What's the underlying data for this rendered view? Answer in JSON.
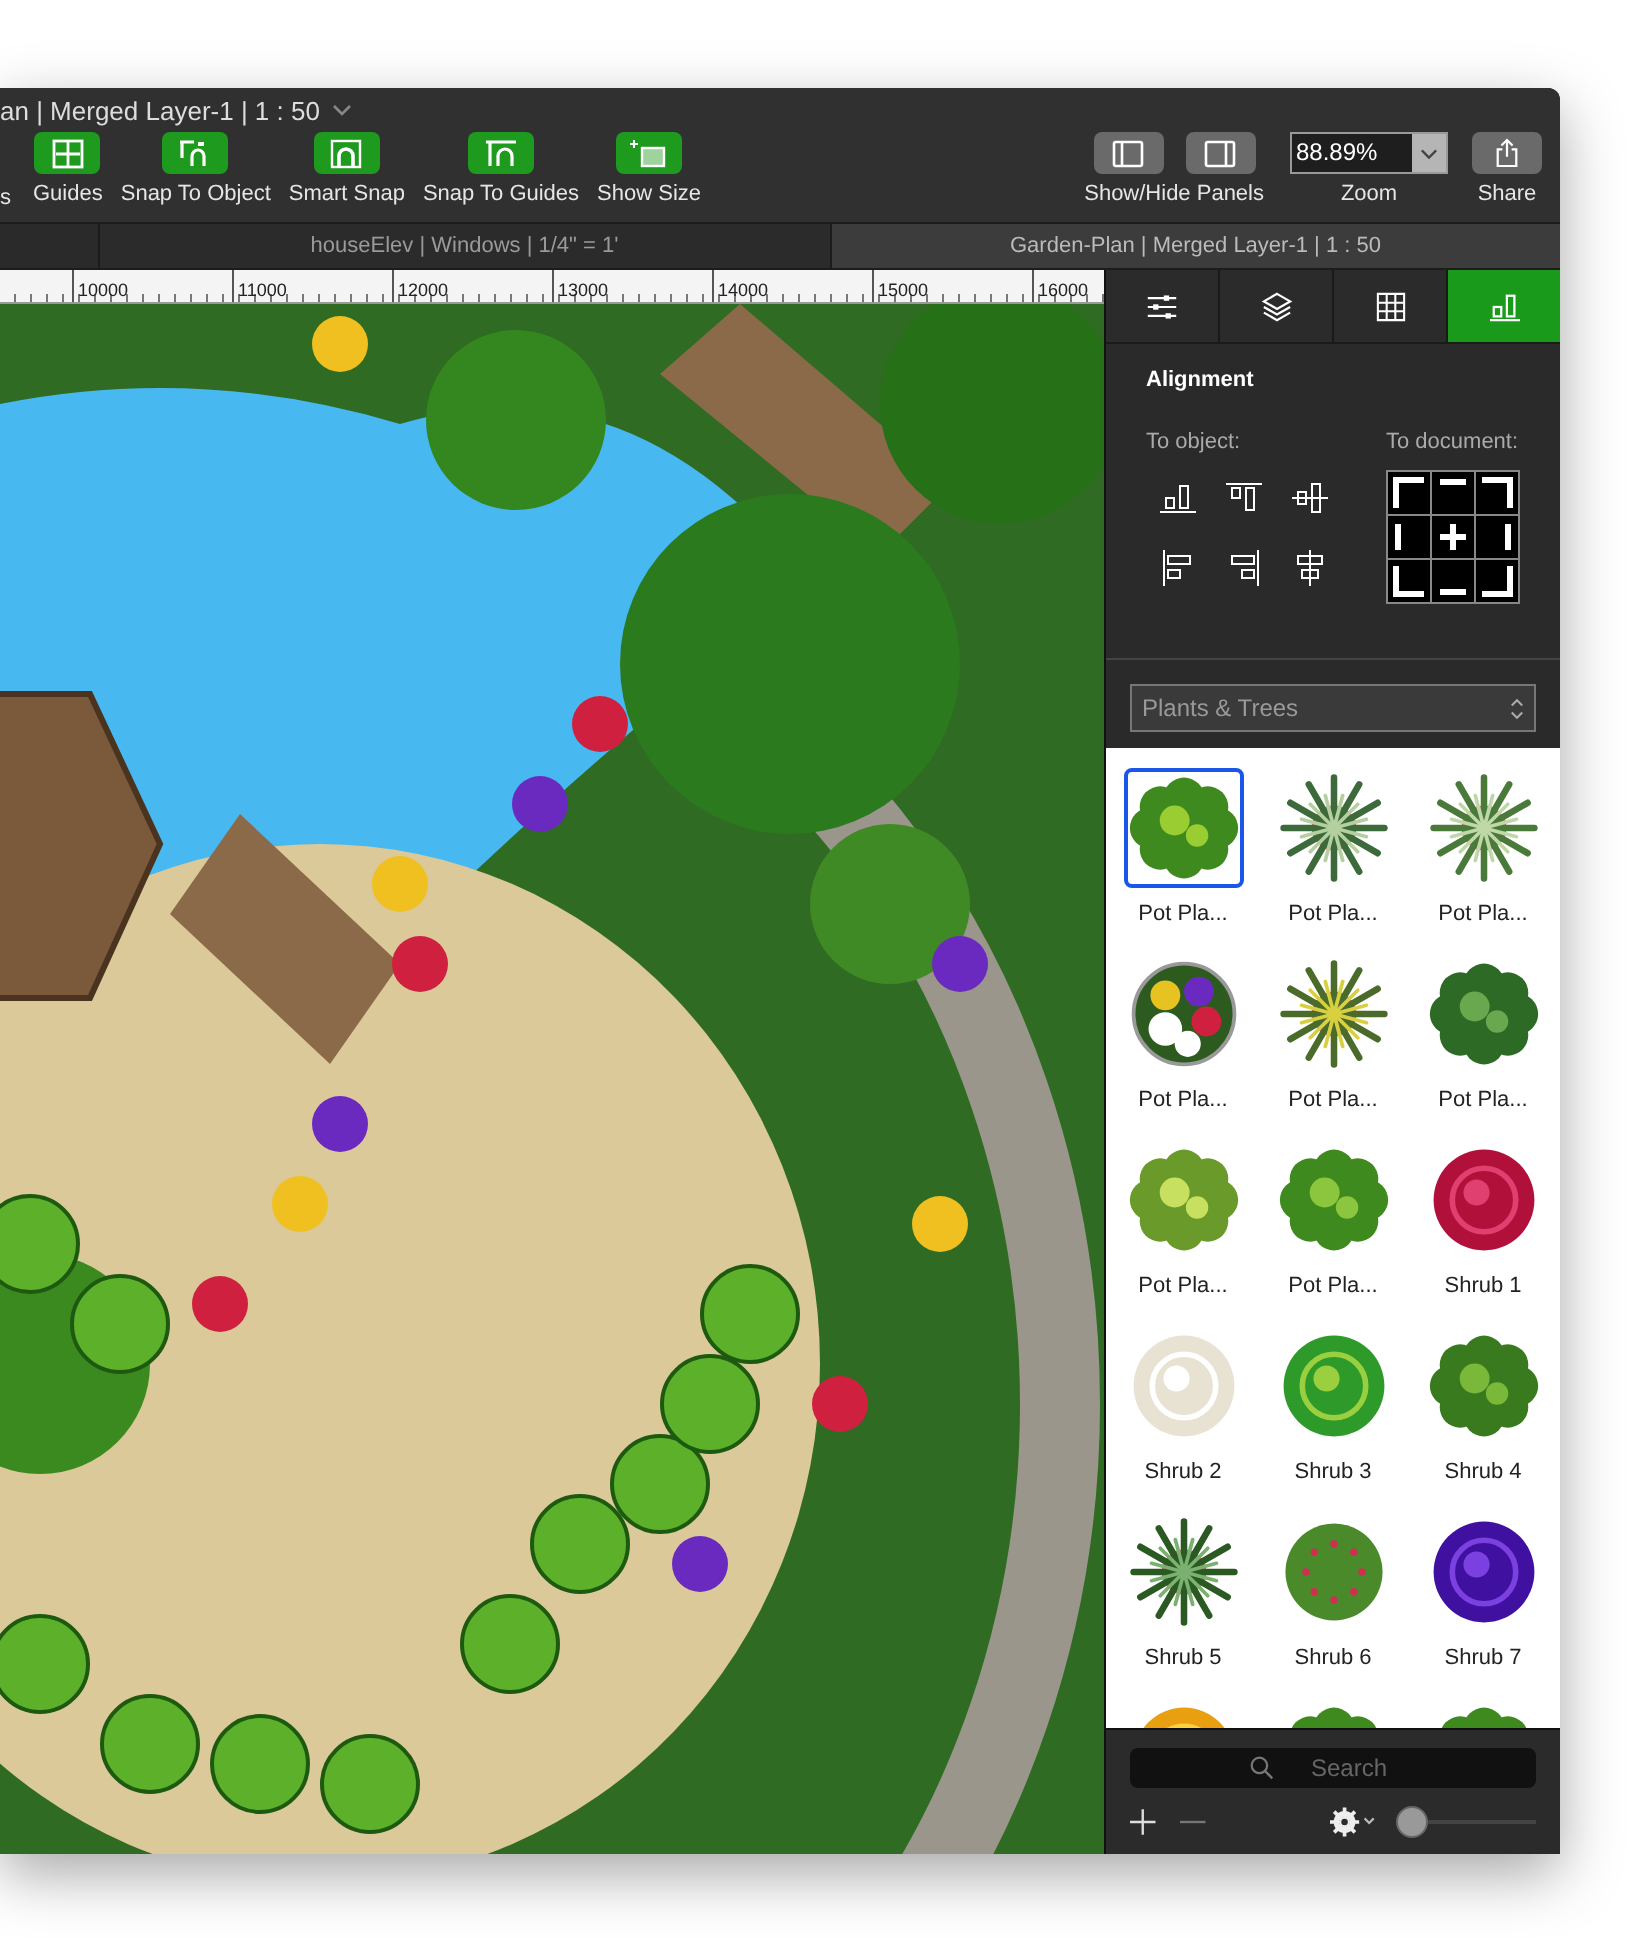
{
  "window": {
    "title": "an | Merged Layer-1 | 1 : 50"
  },
  "toolbar": {
    "cut_label": "s",
    "buttons": [
      {
        "label": "Guides",
        "on": true
      },
      {
        "label": "Snap To Object",
        "on": true
      },
      {
        "label": "Smart Snap",
        "on": true
      },
      {
        "label": "Snap To Guides",
        "on": true
      },
      {
        "label": "Show Size",
        "on": true
      }
    ],
    "panels_label": "Show/Hide Panels",
    "zoom": {
      "value": "88.89%",
      "label": "Zoom"
    },
    "share_label": "Share"
  },
  "document_tabs": [
    {
      "label": "houseElev | Windows | 1/4\" = 1'",
      "selected": false
    },
    {
      "label": "Garden-Plan | Merged Layer-1 | 1 : 50",
      "selected": true
    }
  ],
  "ruler": [
    "10000",
    "11000",
    "12000",
    "13000",
    "14000",
    "15000",
    "16000"
  ],
  "inspector": {
    "tabs": [
      {
        "selected": false
      },
      {
        "selected": false
      },
      {
        "selected": false
      },
      {
        "selected": true
      }
    ],
    "section_title": "Alignment",
    "to_object_label": "To object:",
    "to_document_label": "To document:",
    "library": "Plants & Trees",
    "items": [
      {
        "label": "Pot Pla...",
        "selected": true
      },
      {
        "label": "Pot Pla...",
        "selected": false
      },
      {
        "label": "Pot Pla...",
        "selected": false
      },
      {
        "label": "Pot Pla...",
        "selected": false
      },
      {
        "label": "Pot Pla...",
        "selected": false
      },
      {
        "label": "Pot Pla...",
        "selected": false
      },
      {
        "label": "Pot Pla...",
        "selected": false
      },
      {
        "label": "Pot Pla...",
        "selected": false
      },
      {
        "label": "Shrub 1",
        "selected": false
      },
      {
        "label": "Shrub 2",
        "selected": false
      },
      {
        "label": "Shrub 3",
        "selected": false
      },
      {
        "label": "Shrub 4",
        "selected": false
      },
      {
        "label": "Shrub 5",
        "selected": false
      },
      {
        "label": "Shrub 6",
        "selected": false
      },
      {
        "label": "Shrub 7",
        "selected": false
      }
    ],
    "search_placeholder": "Search",
    "size_slider": {
      "level": 0.05
    }
  }
}
